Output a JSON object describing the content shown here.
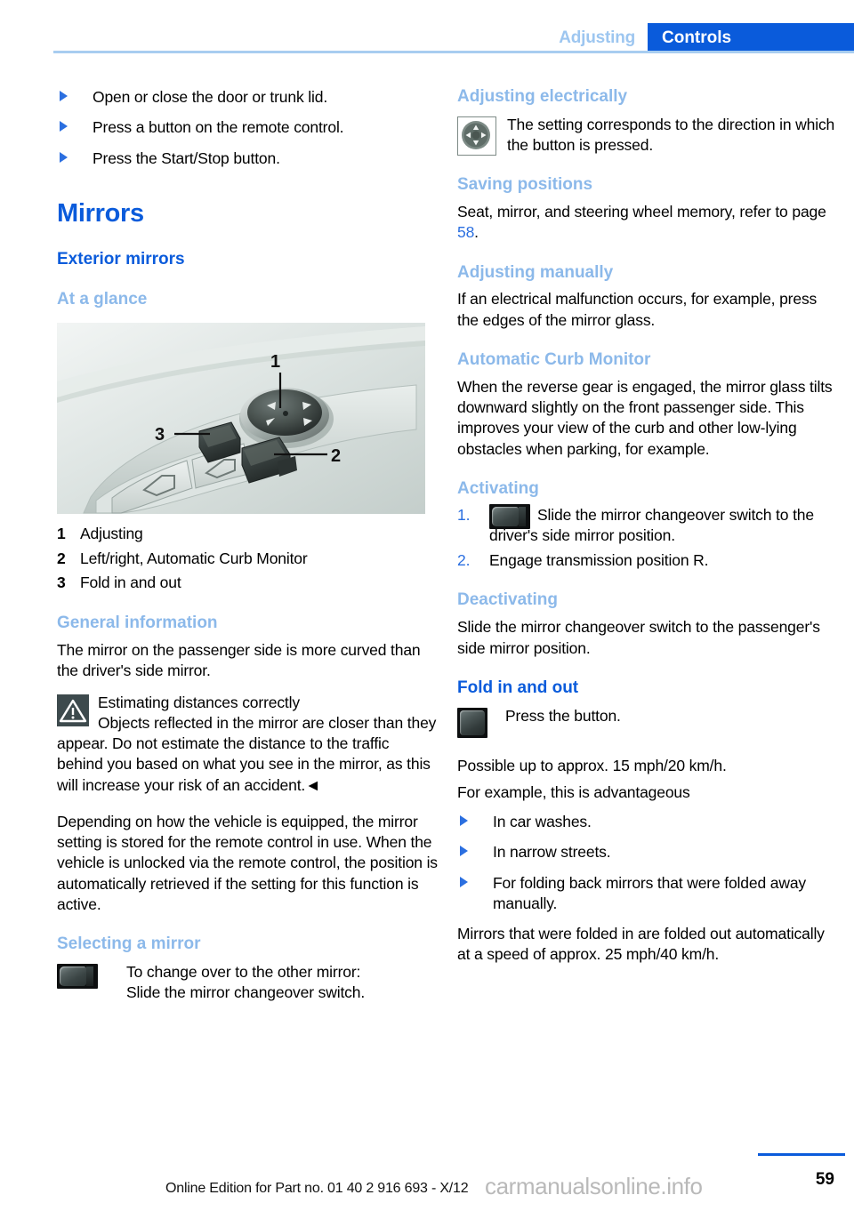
{
  "header": {
    "breadcrumb_secondary": "Adjusting",
    "breadcrumb_active": "Controls",
    "accent_blue": "#0a5bdb",
    "accent_light_blue": "#8cb9ea"
  },
  "left_column": {
    "intro_bullets": [
      "Open or close the door or trunk lid.",
      "Press a button on the remote control.",
      "Press the Start/Stop button."
    ],
    "title": "Mirrors",
    "section_heading": "Exterior mirrors",
    "at_a_glance_heading": "At a glance",
    "figure": {
      "alt": "Driver door panel with mirror adjustment controls",
      "callouts": [
        "1",
        "2",
        "3"
      ]
    },
    "legend": [
      {
        "num": "1",
        "label": "Adjusting"
      },
      {
        "num": "2",
        "label": "Left/right, Automatic Curb Monitor"
      },
      {
        "num": "3",
        "label": "Fold in and out"
      }
    ],
    "general_information": {
      "heading": "General information",
      "paragraph": "The mirror on the passenger side is more curved than the driver's side mirror.",
      "warning": {
        "icon": "warning-triangle-icon",
        "title": "Estimating distances correctly",
        "body": "Objects reflected in the mirror are closer than they appear. Do not estimate the distance to the traffic behind you based on what you see in the mirror, as this will increase your risk of an accident.◄"
      },
      "paragraph2": "Depending on how the vehicle is equipped, the mirror setting is stored for the remote control in use. When the vehicle is unlocked via the remote control, the position is automatically retrieved if the setting for this function is active."
    },
    "selecting_a_mirror": {
      "heading": "Selecting a mirror",
      "icon": "mirror-changeover-switch-icon",
      "line1": "To change over to the other mirror:",
      "line2": "Slide the mirror changeover switch."
    }
  },
  "right_column": {
    "adjusting_electrically": {
      "heading": "Adjusting electrically",
      "icon": "joystick-icon",
      "body": "The setting corresponds to the direction in which the button is pressed."
    },
    "saving_positions": {
      "heading": "Saving positions",
      "body_before": "Seat, mirror, and steering wheel memory, refer to page ",
      "page_ref": "58",
      "body_after": "."
    },
    "adjusting_manually": {
      "heading": "Adjusting manually",
      "body": "If an electrical malfunction occurs, for example, press the edges of the mirror glass."
    },
    "automatic_curb_monitor": {
      "heading": "Automatic Curb Monitor",
      "body": "When the reverse gear is engaged, the mirror glass tilts downward slightly on the front passenger side. This improves your view of the curb and other low-lying obstacles when parking, for example."
    },
    "activating": {
      "heading": "Activating",
      "steps": [
        {
          "num": "1.",
          "icon": "mirror-changeover-switch-icon",
          "text": "Slide the mirror changeover switch to the driver's side mirror position."
        },
        {
          "num": "2.",
          "icon": "",
          "text": "Engage transmission position R."
        }
      ]
    },
    "deactivating": {
      "heading": "Deactivating",
      "body": "Slide the mirror changeover switch to the passenger's side mirror position."
    },
    "fold_in_and_out": {
      "heading": "Fold in and out",
      "icon": "fold-button-icon",
      "icon_text": "Press the button.",
      "paragraph1": "Possible up to approx. 15 mph/20 km/h.",
      "paragraph2": "For example, this is advantageous",
      "bullets": [
        "In car washes.",
        "In narrow streets.",
        "For folding back mirrors that were folded away manually."
      ],
      "paragraph3": "Mirrors that were folded in are folded out automatically at a speed of approx. 25 mph/40 km/h."
    }
  },
  "footer": {
    "edition": "Online Edition for Part no. 01 40 2 916 693 - X/12",
    "watermark": "carmanualsonline.info",
    "page_number": "59"
  }
}
